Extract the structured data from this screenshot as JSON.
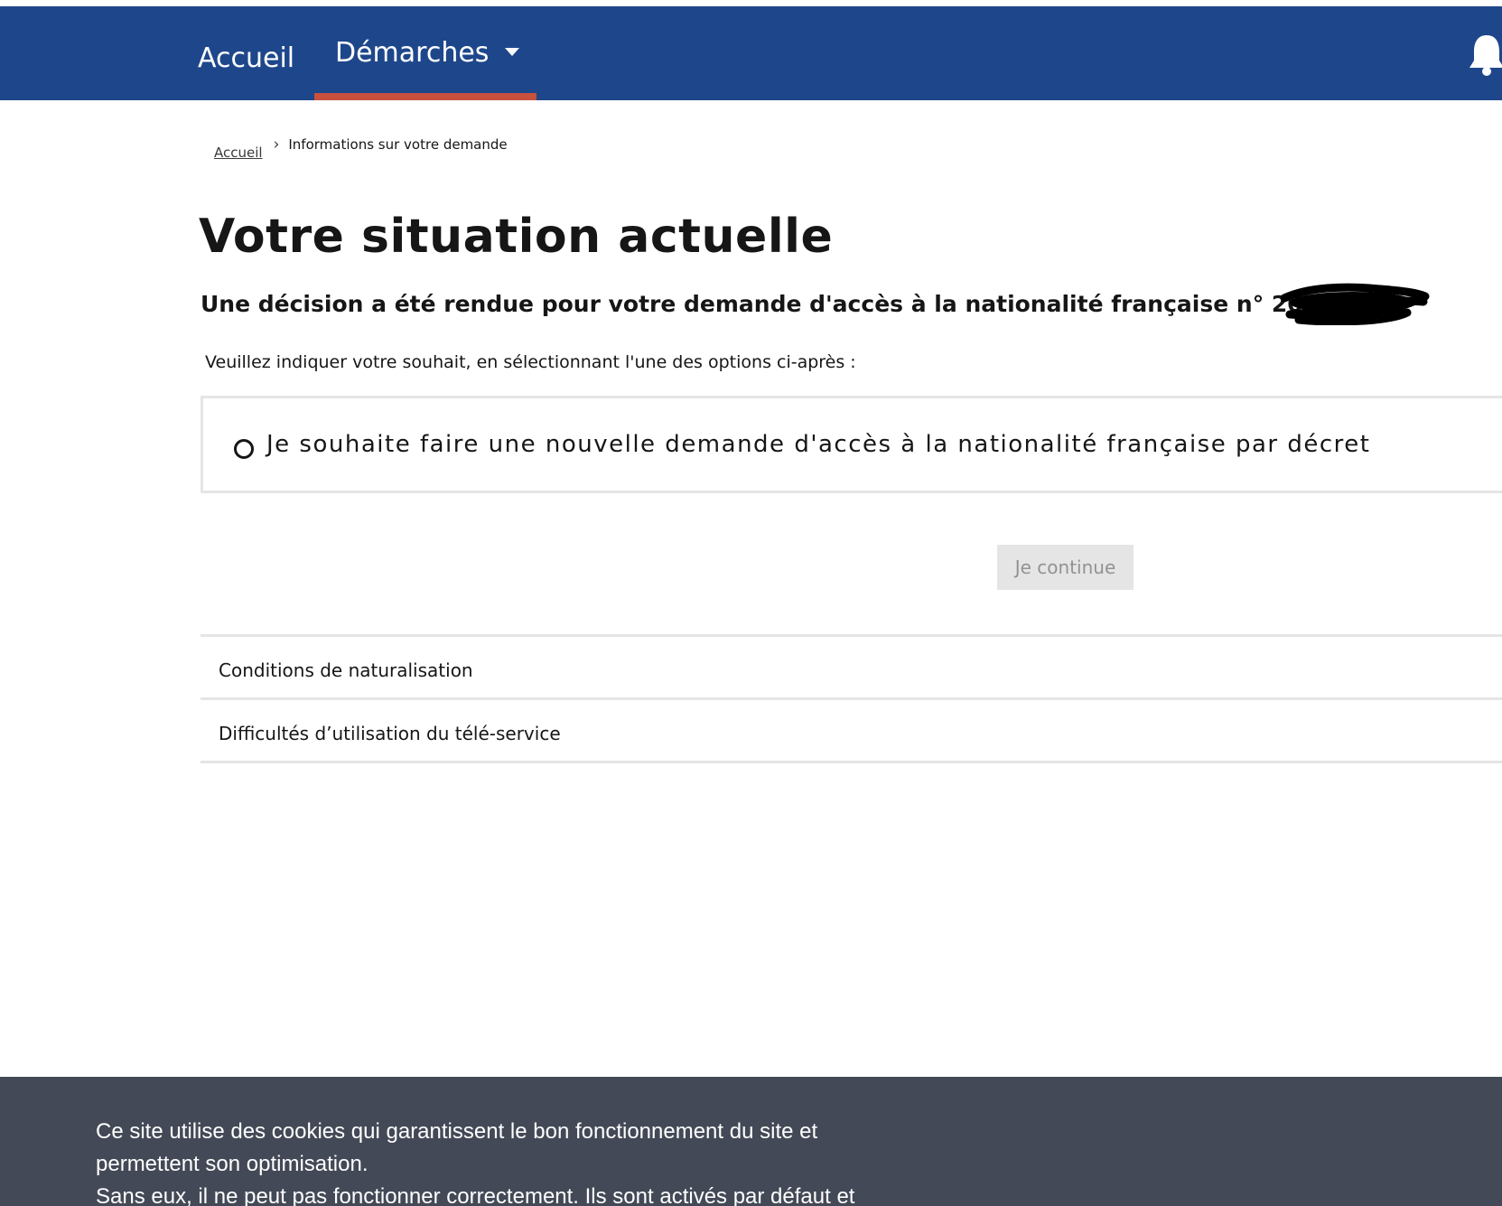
{
  "nav": {
    "items": [
      {
        "label": "Accueil"
      },
      {
        "label": "Démarches"
      }
    ],
    "active_color": "#c8503c",
    "background": "#1e478b"
  },
  "breadcrumb": {
    "home": "Accueil",
    "current": "Informations sur votre demande"
  },
  "page": {
    "title": "Votre situation actuelle",
    "decision": "Une décision a été rendue pour votre demande d'accès à la nationalité française n° 2023X",
    "instruction": "Veuillez indiquer votre souhait, en sélectionnant l'une des options ci-après :"
  },
  "options": [
    {
      "label": "Je souhaite faire une nouvelle demande d'accès à la nationalité française par décret",
      "selected": false
    }
  ],
  "continue_button": "Je continue",
  "accordion": [
    {
      "label": "Conditions de naturalisation"
    },
    {
      "label": "Difficultés d’utilisation du télé-service"
    }
  ],
  "cookie_banner": {
    "lines": [
      "Ce site utilise des cookies qui garantissent le bon fonctionnement du site et",
      "permettent son optimisation.",
      "Sans eux, il ne peut pas fonctionner correctement. Ils sont activés par défaut et"
    ]
  }
}
